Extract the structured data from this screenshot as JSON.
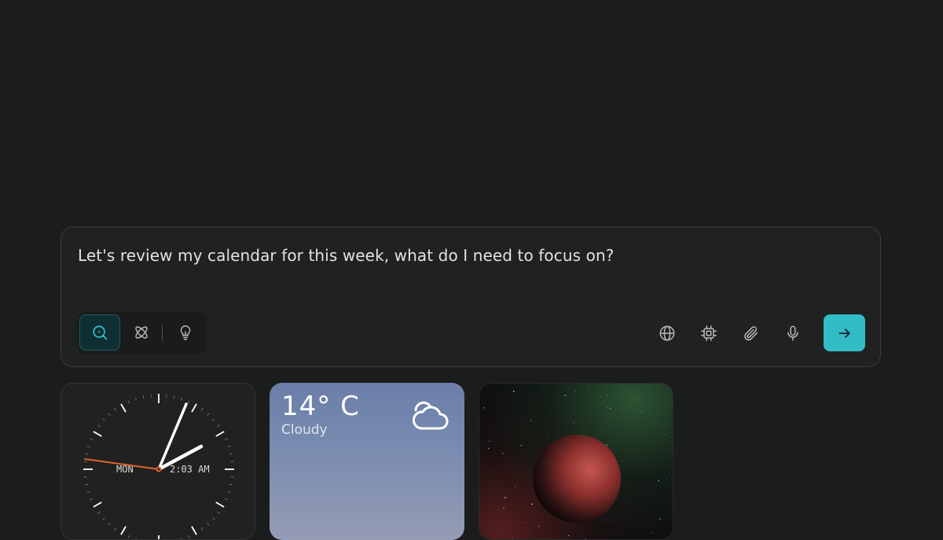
{
  "composer": {
    "prompt_text": "Let's review my calendar for this week, what do I need to focus on?",
    "modes": [
      {
        "name": "search",
        "icon": "search-sparkle-icon",
        "active": true
      },
      {
        "name": "research",
        "icon": "atom-icon",
        "active": false
      },
      {
        "name": "ideas",
        "icon": "lightbulb-icon",
        "active": false
      }
    ],
    "tools": [
      "globe-icon",
      "chip-icon",
      "paperclip-icon",
      "microphone-icon"
    ],
    "send_icon": "arrow-right-icon",
    "accent_color": "#31bcc6"
  },
  "widgets": {
    "clock": {
      "day_label": "MON",
      "time_label": "2:03 AM",
      "second_hand_color": "#e0632a"
    },
    "weather": {
      "temperature": "14° C",
      "condition": "Cloudy",
      "icon": "cloud-sun-icon"
    },
    "space": {
      "image": "planet-image"
    }
  }
}
